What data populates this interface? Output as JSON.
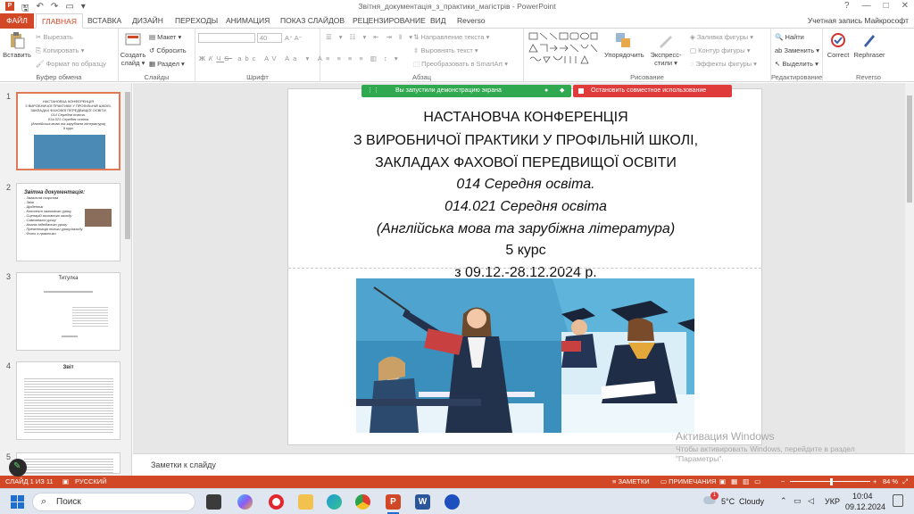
{
  "window": {
    "title": "Звітня_документація_з_практики_магістрів - PowerPoint",
    "controls": [
      "?",
      "—",
      "□",
      "✕"
    ]
  },
  "tabs": [
    "ФАЙЛ",
    "ГЛАВНАЯ",
    "ВСТАВКА",
    "ДИЗАЙН",
    "ПЕРЕХОДЫ",
    "АНИМАЦИЯ",
    "ПОКАЗ СЛАЙДОВ",
    "РЕЦЕНЗИРОВАНИЕ",
    "ВИД",
    "Reverso"
  ],
  "account": "Учетная запись Майкрософт",
  "ribbon": {
    "clipboard": {
      "paste": "Вставить",
      "cut": "Вырезать",
      "copy": "Копировать",
      "format": "Формат по образцу",
      "label": "Буфер обмена"
    },
    "slides": {
      "new": "Создать слайд",
      "layout": "Макет",
      "reset": "Сбросить",
      "section": "Раздел",
      "label": "Слайды"
    },
    "font": {
      "size": "40",
      "bold": "Ж",
      "italic": "К",
      "underline": "Ч",
      "strike": "S",
      "label": "Шрифт"
    },
    "paragraph": {
      "direction": "Направление текста",
      "align": "Выровнять текст",
      "smartart": "Преобразовать в SmartArt",
      "label": "Абзац"
    },
    "drawing": {
      "arrange": "Упорядочить",
      "styles": "Экспресс-стили",
      "fill": "Заливка фигуры",
      "outline": "Контур фигуры",
      "effects": "Эффекты фигуры",
      "label": "Рисование"
    },
    "editing": {
      "find": "Найти",
      "replace": "Заменить",
      "select": "Выделить",
      "label": "Редактирование"
    },
    "reverso": {
      "correct": "Correct",
      "rephrase": "Rephraser",
      "label": "Reverso"
    }
  },
  "thumbnails": [
    {
      "num": "1",
      "lines": [
        "НАСТАНОВЧА КОНФЕРЕНЦІЯ",
        "З ВИРОБНИЧОЇ ПРАКТИКИ У ПРОФІЛЬНІЙ ШКОЛІ,",
        "ЗАКЛАДАХ ФАХОВОЇ ПЕРЕДВИЩОЇ ОСВІТИ",
        "014 Середня освіта.",
        "014.021 Середня освіта",
        "(Англійська мова та зарубіжна література)",
        "5 курс"
      ]
    },
    {
      "num": "2",
      "title": "Звітна документація:",
      "lines": [
        "- Загальна спарсова",
        "- Звіт",
        "- Щоденник",
        "- Конспект залікового уроку",
        "- Сценарій виховного заходу",
        "- Самоаналіз уроку",
        "- Аналіз відвіданого уроку",
        "- Презентація тільки уроку/заходу",
        "- Фото з практики"
      ]
    },
    {
      "num": "3",
      "title": "Титулка"
    },
    {
      "num": "4",
      "title": "Звіт"
    },
    {
      "num": "5"
    }
  ],
  "share": {
    "running": "Вы запустили демонстрацию экрана",
    "stop": "Остановить совместное использование"
  },
  "slide": {
    "lines": [
      "НАСТАНОВЧА КОНФЕРЕНЦІЯ",
      "З ВИРОБНИЧОЇ ПРАКТИКИ У ПРОФІЛЬНІЙ ШКОЛІ,",
      "ЗАКЛАДАХ ФАХОВОЇ ПЕРЕДВИЩОЇ ОСВІТИ",
      "014 Середня освіта.",
      "014.021 Середня освіта",
      "(Англійська мова та зарубіжна література)",
      "5 курс",
      "з 09.12.-28.12.2024 р."
    ]
  },
  "notes": {
    "placeholder": "Заметки к слайду"
  },
  "watermark": {
    "title": "Активация Windows",
    "body": "Чтобы активировать Windows, перейдите в раздел \"Параметры\"."
  },
  "status": {
    "slide": "СЛАЙД 1 ИЗ 11",
    "lang": "РУССКИЙ",
    "notes": "ЗАМЕТКИ",
    "comments": "ПРИМЕЧАНИЯ",
    "zoom": "84 %"
  },
  "taskbar": {
    "search": "Поиск",
    "weather_temp": "5°C",
    "weather_text": "Cloudy",
    "lang": "УКР",
    "time": "10:04",
    "date": "09.12.2024",
    "weather_badge": "1"
  }
}
